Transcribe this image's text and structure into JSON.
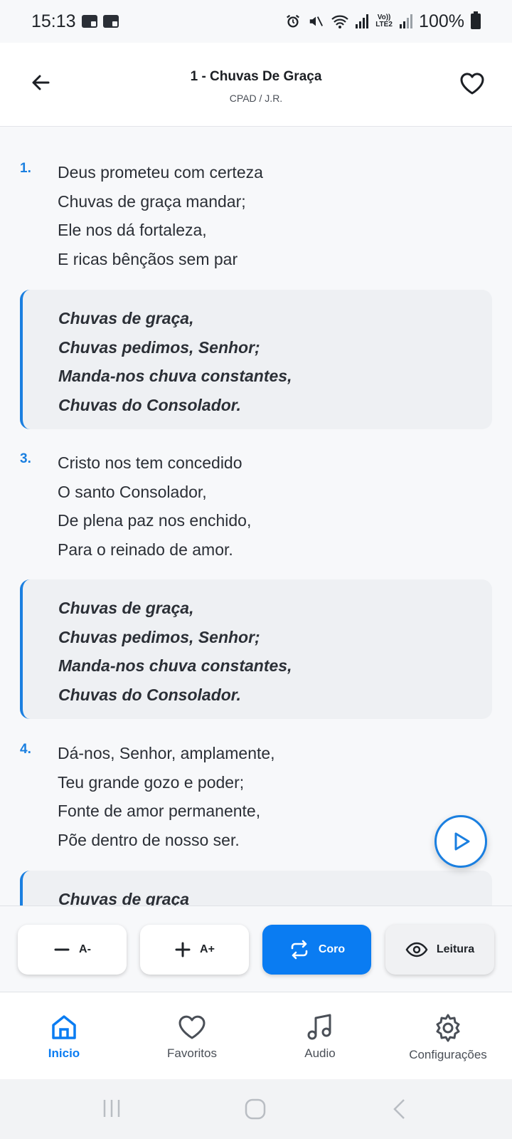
{
  "status_bar": {
    "time": "15:13",
    "battery": "100%",
    "network_label": "Vo)) LTE2"
  },
  "header": {
    "title": "1 - Chuvas De Graça",
    "subtitle": "CPAD / J.R."
  },
  "hymn": {
    "verses": [
      {
        "number": "1.",
        "lines": [
          "Deus prometeu com certeza",
          "Chuvas de graça mandar;",
          "Ele nos dá fortaleza,",
          "E ricas bênçãos sem par"
        ]
      },
      {
        "number": "3.",
        "lines": [
          "Cristo nos tem concedido",
          "O santo Consolador,",
          "De plena paz nos enchido,",
          "Para o reinado de amor."
        ]
      },
      {
        "number": "4.",
        "lines": [
          "Dá-nos, Senhor, amplamente,",
          "Teu grande gozo e poder;",
          "Fonte de amor permanente,",
          "Põe dentro de nosso ser."
        ]
      }
    ],
    "chorus": [
      "Chuvas de graça,",
      "Chuvas pedimos, Senhor;",
      "Manda-nos chuva constantes,",
      "Chuvas do Consolador."
    ],
    "chorus_partial": "Chuvas de graça"
  },
  "controls": {
    "font_decrease": "A-",
    "font_increase": "A+",
    "chorus": "Coro",
    "reading": "Leitura"
  },
  "nav": {
    "home": "Inicio",
    "favorites": "Favoritos",
    "audio": "Audio",
    "settings": "Configurações"
  },
  "colors": {
    "accent": "#0a7cf2",
    "verse_number": "#1a7fe0",
    "chorus_bg": "#eef0f3"
  }
}
